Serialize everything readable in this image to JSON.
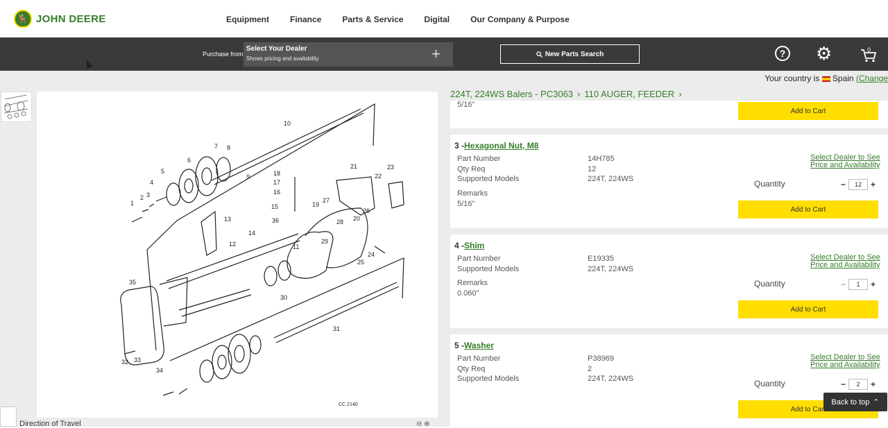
{
  "brand": {
    "name": "JOHN DEERE",
    "color": "#367c2b",
    "accent": "#ffde00"
  },
  "nav": [
    "Equipment",
    "Finance",
    "Parts & Service",
    "Digital",
    "Our Company & Purpose"
  ],
  "toolbar": {
    "purchase_from": "Purchase from",
    "dealer_title": "Select Your Dealer",
    "dealer_sub": "Shows pricing and availability",
    "search_label": "New Parts Search",
    "cart_count": "0"
  },
  "country": {
    "prefix": "Your country is",
    "name": "Spain",
    "open_paren": "(",
    "change": "Change"
  },
  "breadcrumb": [
    "224T, 224WS Balers - PC3063",
    "110 AUGER, FEEDER"
  ],
  "diagram": {
    "code": "CC 2140",
    "direction": "Direction of Travel",
    "callouts": [
      "1",
      "2",
      "3",
      "4",
      "5",
      "6",
      "7",
      "8",
      "9",
      "10",
      "11",
      "12",
      "13",
      "14",
      "15",
      "16",
      "17",
      "18",
      "19",
      "20",
      "21",
      "22",
      "23",
      "24",
      "25",
      "26",
      "27",
      "28",
      "29",
      "30",
      "31",
      "32",
      "33",
      "34",
      "35",
      "36"
    ]
  },
  "labels": {
    "part_number": "Part Number",
    "qty_req": "Qty Req",
    "supported_models": "Supported Models",
    "remarks": "Remarks",
    "quantity": "Quantity",
    "select_dealer_1": "Select Dealer to See",
    "select_dealer_2": "Price and Availability",
    "add_to_cart": "Add to Cart",
    "back_to_top": "Back to top"
  },
  "partial_card": {
    "remark": "5/16\""
  },
  "parts": [
    {
      "num": "3 -",
      "name": "Hexagonal Nut, M8",
      "part_number": "14H785",
      "qty_req": "12",
      "models": "224T, 224WS",
      "remarks": "5/16\"",
      "quantity": "12"
    },
    {
      "num": "4 -",
      "name": "Shim",
      "part_number": "E19335",
      "models": "224T, 224WS",
      "remarks": "0.060\"",
      "quantity": "1"
    },
    {
      "num": "5 -",
      "name": "Washer",
      "part_number": "P38969",
      "qty_req": "2",
      "models": "224T, 224WS",
      "quantity": "2"
    }
  ]
}
